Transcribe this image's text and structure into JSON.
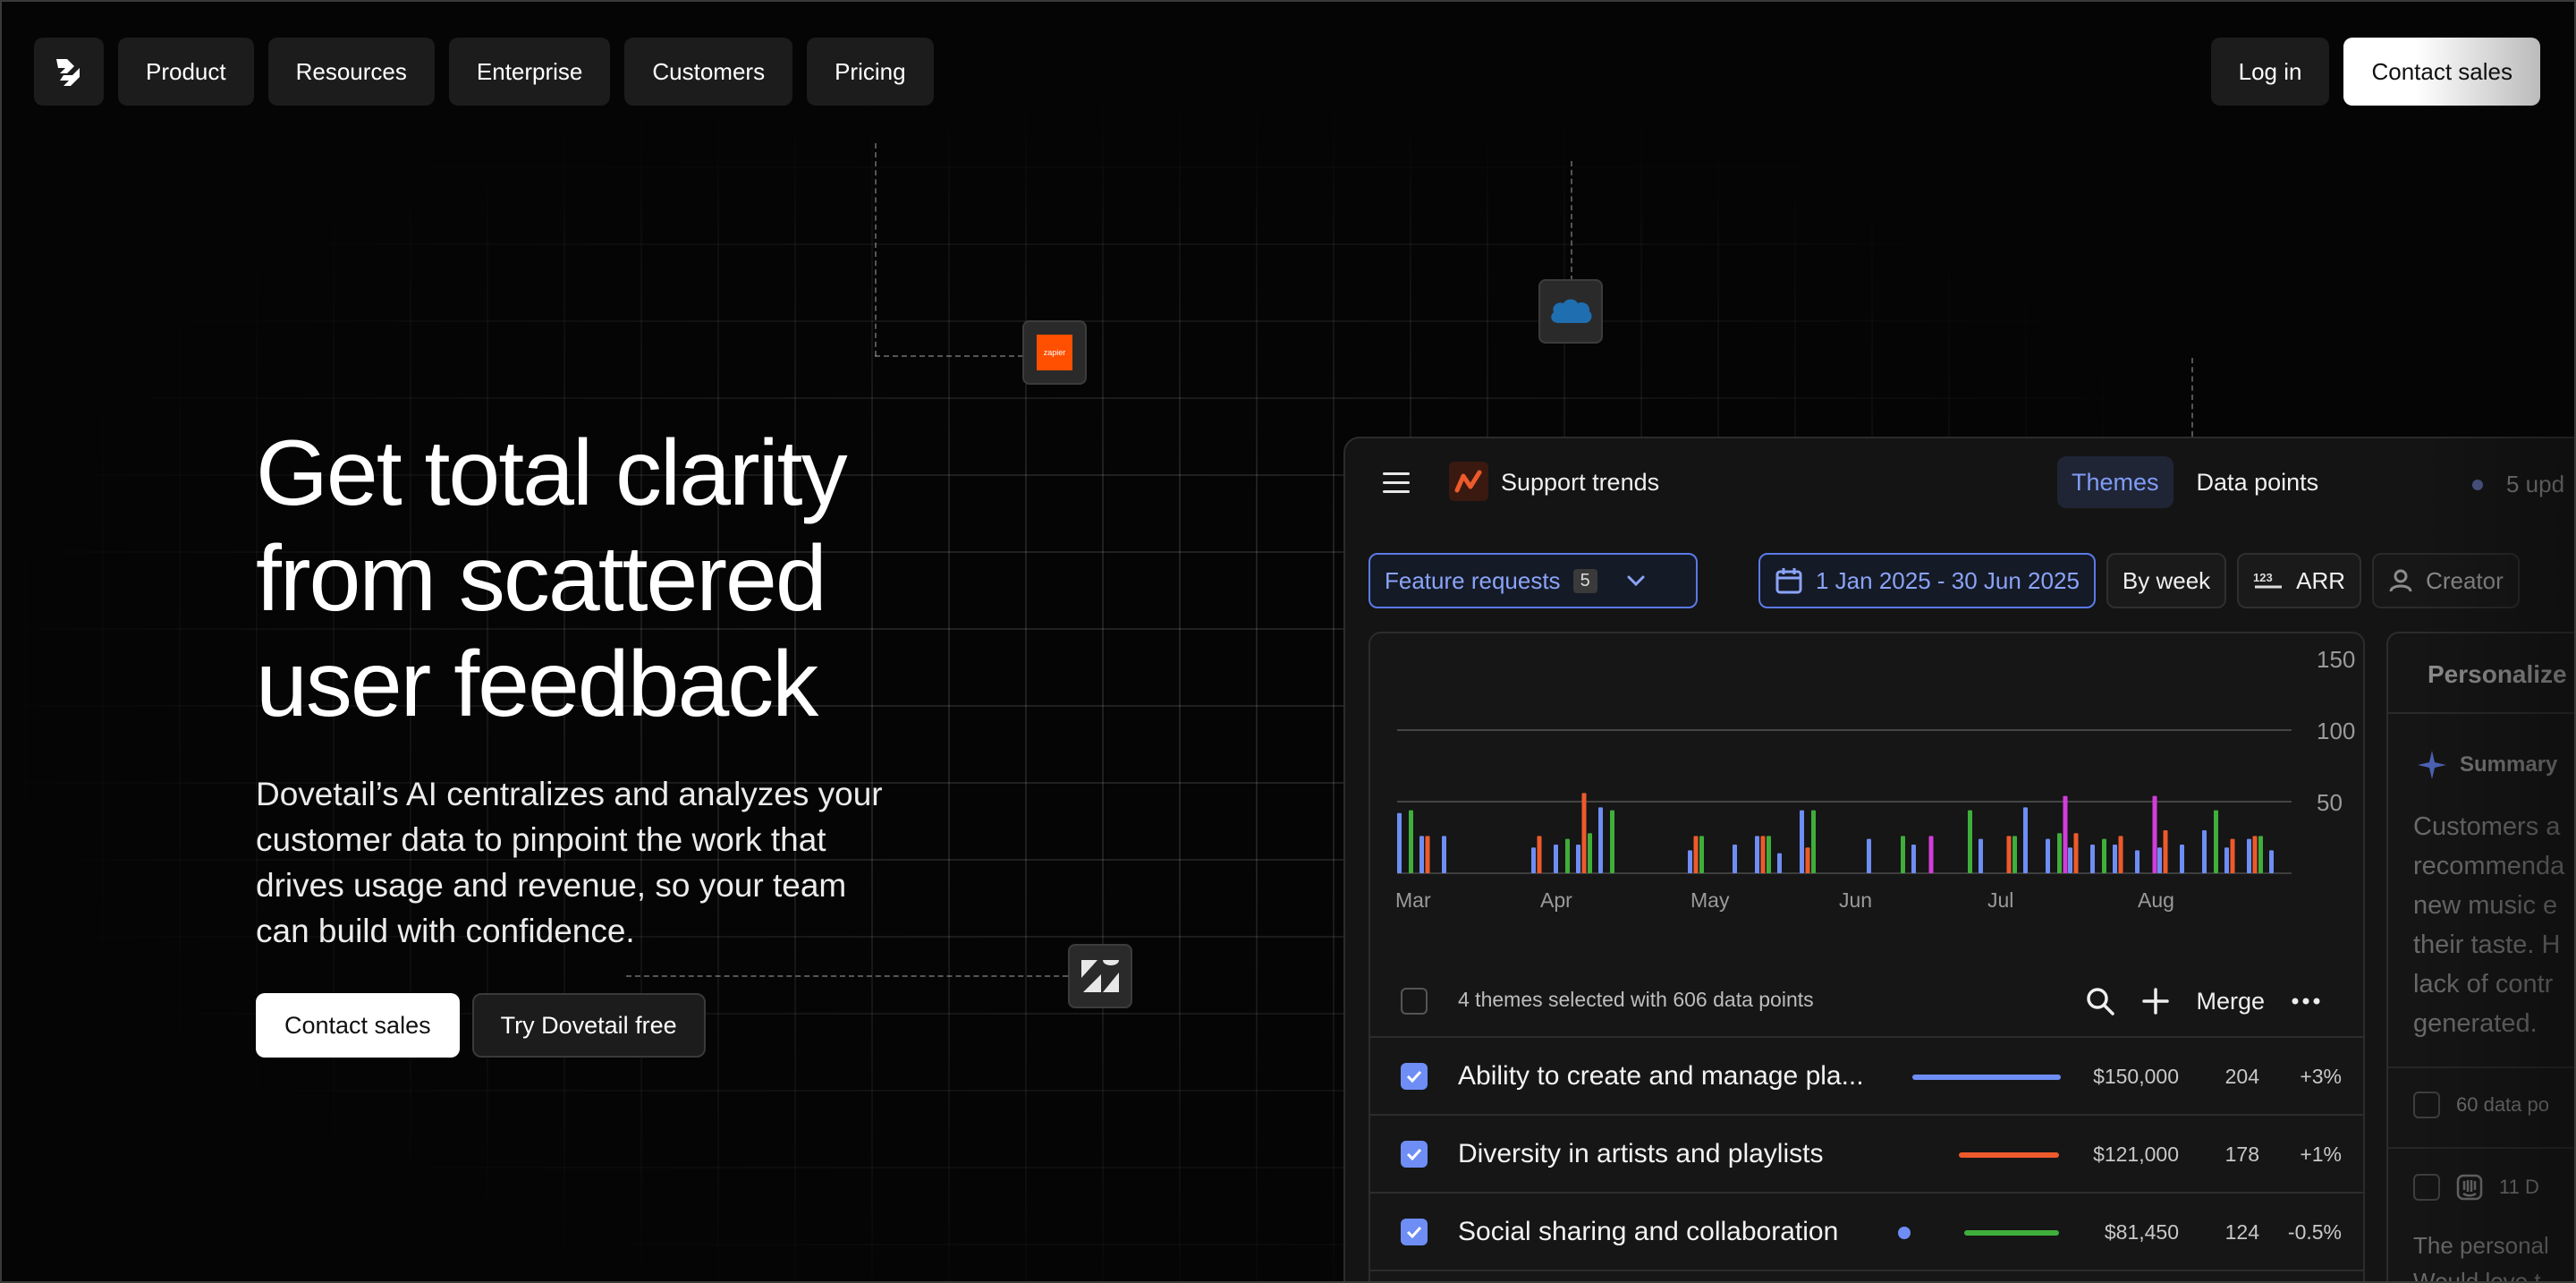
{
  "nav": {
    "logo": "dovetail-logo-icon",
    "items": [
      "Product",
      "Resources",
      "Enterprise",
      "Customers",
      "Pricing"
    ],
    "login": "Log in",
    "contact": "Contact sales"
  },
  "integrations": {
    "zapier_text": "zapier",
    "icons": [
      "zapier-icon",
      "salesforce-icon",
      "zendesk-icon"
    ],
    "colors": {
      "zapier": "#ff4f00",
      "salesforce": "#1f6fb0"
    }
  },
  "hero": {
    "title_lines": [
      "Get total clarity",
      "from scattered",
      "user feedback"
    ],
    "subtitle_lines": [
      "Dovetail’s AI centralizes and analyzes your",
      "customer data to pinpoint the work that",
      "drives usage and revenue, so your team",
      "can build with confidence."
    ],
    "cta_primary": "Contact sales",
    "cta_secondary": "Try Dovetail free"
  },
  "panel": {
    "title": "Support trends",
    "tabs": [
      {
        "label": "Themes",
        "active": true
      },
      {
        "label": "Data points",
        "active": false
      }
    ],
    "updates": "5 upd",
    "filters": {
      "feature": "Feature requests",
      "feature_count": "5",
      "date_range": "1 Jan 2025 - 30 Jun 2025",
      "grouping": "By week",
      "metric": "ARR",
      "creator": "Creator"
    },
    "selection_text": "4 themes selected with 606 data points",
    "merge": "Merge",
    "rows": [
      {
        "name": "Ability to create and manage pla...",
        "color": "#6e8ef5",
        "arr": "$150,000",
        "count": "204",
        "change": "+3%",
        "bar": 1.0,
        "dot": false
      },
      {
        "name": "Diversity in artists and playlists",
        "color": "#ee5a2c",
        "arr": "$121,000",
        "count": "178",
        "change": "+1%",
        "bar": 0.68,
        "dot": false
      },
      {
        "name": "Social sharing and collaboration",
        "color": "#3fae3a",
        "arr": "$81,450",
        "count": "124",
        "change": "-0.5%",
        "bar": 0.65,
        "dot": true
      }
    ],
    "side": {
      "title": "Personalize",
      "summary_label": "Summary",
      "body_lines": [
        "Customers a",
        "recommenda",
        "new music e",
        "their taste. H",
        "lack of contr",
        "generated."
      ],
      "rows": [
        "60 data po",
        "11 D"
      ],
      "body2_lines": [
        "The personal",
        "Would love t"
      ]
    }
  },
  "chart_data": {
    "type": "bar",
    "x_tick_labels": [
      "Mar",
      "Apr",
      "May",
      "Jun",
      "Jul",
      "Aug"
    ],
    "y_tick_labels": [
      "150",
      "100",
      "50"
    ],
    "ylim": [
      0,
      150
    ],
    "grid": true,
    "series": [
      {
        "color": "#6e8ef5",
        "values": [
          42,
          26,
          26,
          0,
          0,
          0,
          18,
          20,
          20,
          46,
          0,
          0,
          0,
          16,
          0,
          20,
          26,
          14,
          44,
          0,
          0,
          24,
          0,
          20,
          0,
          0,
          24,
          0,
          46,
          24,
          18,
          20,
          20,
          16,
          18,
          20,
          30,
          18,
          24,
          16
        ]
      },
      {
        "color": "#ee5a2c",
        "values": [
          0,
          26,
          0,
          0,
          0,
          0,
          26,
          0,
          56,
          0,
          0,
          0,
          0,
          26,
          0,
          0,
          26,
          0,
          18,
          0,
          0,
          0,
          0,
          0,
          0,
          0,
          0,
          26,
          0,
          0,
          28,
          0,
          26,
          0,
          30,
          0,
          0,
          24,
          26,
          0
        ]
      },
      {
        "color": "#3fae3a",
        "values": [
          44,
          0,
          0,
          0,
          0,
          0,
          0,
          24,
          28,
          44,
          0,
          0,
          0,
          26,
          0,
          0,
          26,
          0,
          44,
          0,
          0,
          0,
          26,
          0,
          0,
          44,
          0,
          26,
          0,
          28,
          0,
          24,
          0,
          0,
          0,
          0,
          44,
          0,
          26,
          0
        ]
      },
      {
        "color": "#d23ddb",
        "values": [
          0,
          0,
          0,
          0,
          0,
          0,
          0,
          0,
          0,
          0,
          0,
          0,
          0,
          0,
          0,
          0,
          0,
          0,
          0,
          0,
          0,
          0,
          0,
          26,
          0,
          0,
          0,
          0,
          0,
          54,
          0,
          0,
          0,
          54,
          0,
          0,
          0,
          0,
          0,
          0
        ]
      }
    ]
  }
}
